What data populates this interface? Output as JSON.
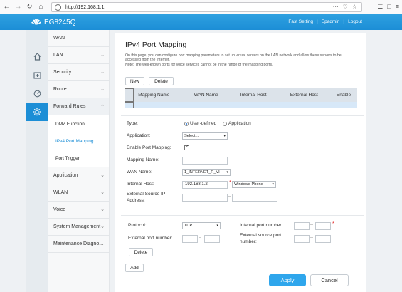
{
  "browser": {
    "url": "http://192.168.1.1",
    "nav": [
      "back-icon",
      "forward-icon",
      "reload-icon",
      "home-icon"
    ],
    "url_actions": [
      "···",
      "♡",
      "☆"
    ]
  },
  "header": {
    "brand": "EG8245Q",
    "links": [
      "Fast Setting",
      "Epadmin",
      "Logout"
    ]
  },
  "icon_sidebar": [
    "home-icon",
    "status-icon",
    "speed-icon",
    "settings-icon"
  ],
  "menu": {
    "items_top": [
      "WAN",
      "LAN",
      "Security",
      "Route"
    ],
    "open_item": "Forward Rules",
    "sub_items": [
      "DMZ Function",
      "IPv4 Port Mapping",
      "Port Trigger"
    ],
    "items_bottom": [
      "Application",
      "WLAN",
      "Voice",
      "System Management",
      "Maintenance Diagno..."
    ]
  },
  "main": {
    "title": "IPv4 Port Mapping",
    "description": "On this page, you can configure port mapping parameters to set up virtual servers on the LAN network and allow these servers to be accessed from the Internet.\nNote: The well-known ports for voice services cannot be in the range of the mapping ports.",
    "new_label": "New",
    "delete_label": "Delete",
    "table": {
      "headers": [
        "Mapping Name",
        "WAN Name",
        "Internal Host",
        "External Host",
        "Enable"
      ],
      "row": [
        "----",
        "----",
        "----",
        "----",
        "----",
        "----"
      ]
    },
    "form": {
      "type_label": "Type:",
      "type_options": [
        "User-defined",
        "Application"
      ],
      "application_label": "Application:",
      "application_value": "Select...",
      "enable_label": "Enable Port Mapping:",
      "mapping_name_label": "Mapping Name:",
      "wan_name_label": "WAN Name:",
      "wan_name_value": "1_INTERNET_R_VI",
      "internal_host_label": "Internal Host:",
      "internal_host_value": "192.168.1.2",
      "internal_host_select": "Windows-Phone",
      "ext_source_ip_label": "External Source IP Address:"
    },
    "ports": {
      "protocol_label": "Protocol:",
      "protocol_value": "TCP",
      "internal_port_label": "Internal port number:",
      "external_port_label": "External port number:",
      "external_source_port_label": "External source port number:",
      "delete_label": "Delete",
      "range_sep": "--",
      "required_mark": "*"
    },
    "add_label": "Add",
    "apply_label": "Apply",
    "cancel_label": "Cancel"
  }
}
